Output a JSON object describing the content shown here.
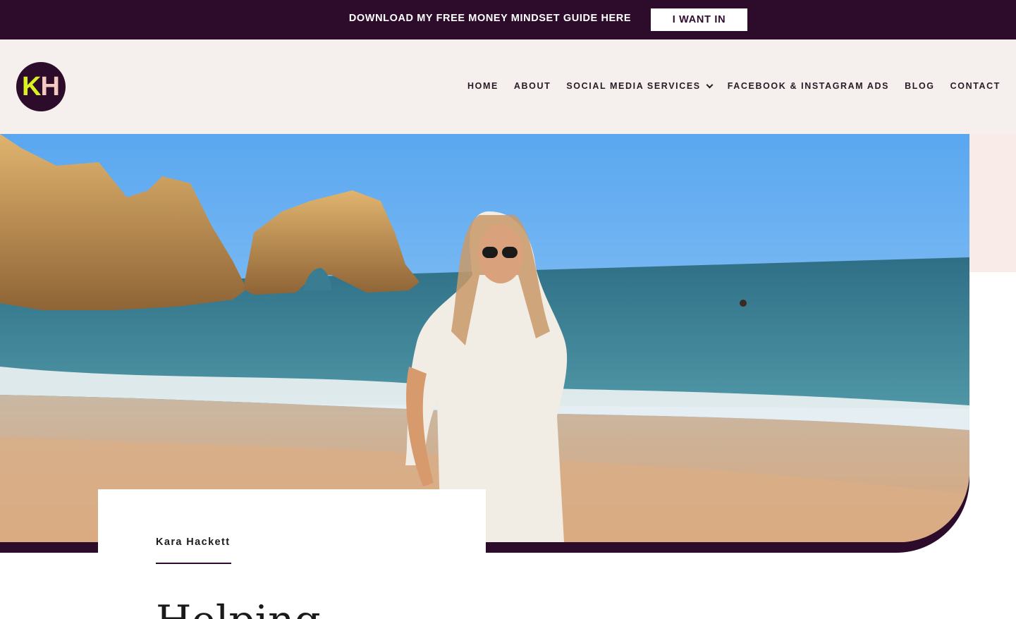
{
  "promo": {
    "text": "DOWNLOAD MY FREE MONEY MINDSET GUIDE HERE",
    "button_label": "I WANT IN"
  },
  "logo": {
    "letter1": "K",
    "letter2": "H"
  },
  "nav": {
    "items": [
      {
        "label": "HOME"
      },
      {
        "label": "ABOUT"
      },
      {
        "label": "SOCIAL MEDIA SERVICES",
        "has_dropdown": true
      },
      {
        "label": "FACEBOOK & INSTAGRAM ADS"
      },
      {
        "label": "BLOG"
      },
      {
        "label": "CONTACT"
      }
    ]
  },
  "hero": {
    "image_subject": "beach-photo"
  },
  "card": {
    "name": "Kara Hackett",
    "heading_partial": "Helping"
  },
  "colors": {
    "brand_dark": "#2d0c2b",
    "header_bg": "#f5efee",
    "logo_k": "#d9f021",
    "logo_h": "#f3c9c0"
  }
}
